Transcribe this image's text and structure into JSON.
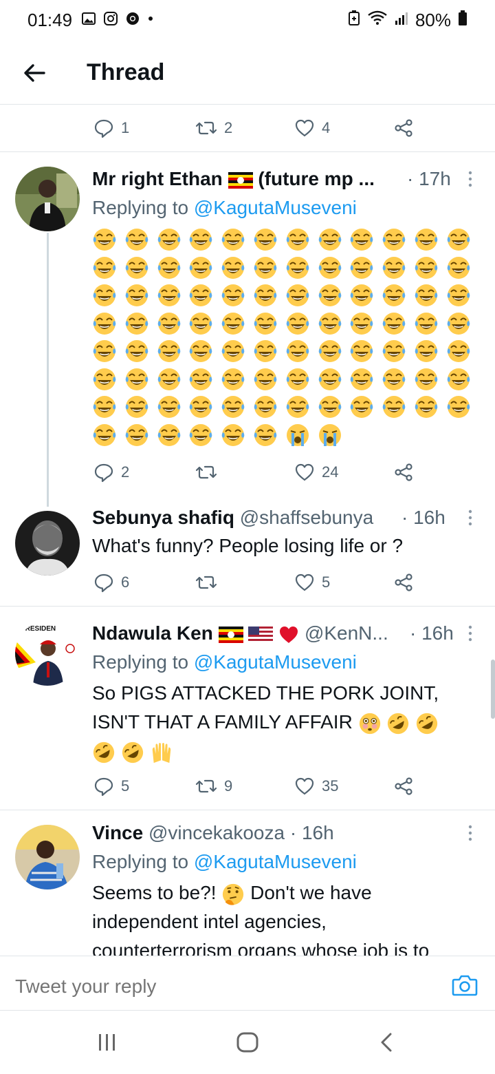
{
  "status_bar": {
    "time": "01:49",
    "battery": "80%"
  },
  "header": {
    "title": "Thread"
  },
  "top_actions": {
    "replies": "1",
    "retweets": "2",
    "likes": "4"
  },
  "tweets": [
    {
      "name": "Mr right Ethan",
      "name_suffix": "(future mp ...",
      "handle": "",
      "time": "· 17h",
      "replying_prefix": "Replying to ",
      "replying_to": "@KagutaMuseveni",
      "text_lines": [],
      "emoji_laughing_count": 90,
      "emoji_crying_count": 2,
      "actions": {
        "replies": "2",
        "retweets": "",
        "likes": "24"
      }
    },
    {
      "name": "Sebunya shafiq",
      "handle": "@shaffsebunya",
      "time": "· 16h",
      "text_lines": [
        "What's funny? People losing life or ?"
      ],
      "actions": {
        "replies": "6",
        "retweets": "",
        "likes": "5"
      }
    },
    {
      "name": "Ndawula Ken",
      "handle": "@KenN...",
      "time": "· 16h",
      "replying_prefix": "Replying to ",
      "replying_to": "@KagutaMuseveni",
      "text_lines": [
        "So PIGS ATTACKED THE PORK JOINT,",
        "ISN'T THAT A FAMILY AFFAIR"
      ],
      "avatar_caption": "PRESIDEN",
      "actions": {
        "replies": "5",
        "retweets": "9",
        "likes": "35"
      }
    },
    {
      "name": "Vince",
      "handle": "@vincekakooza",
      "time": "· 16h",
      "replying_prefix": "Replying to ",
      "replying_to": "@KagutaMuseveni",
      "text_lines": [
        "Seems to be?!",
        "Don't we have",
        "independent intel agencies,",
        "counterterrorism organs whose job is to"
      ]
    }
  ],
  "reply_bar": {
    "placeholder": "Tweet your reply"
  },
  "colors": {
    "accent": "#1d9bf0",
    "secondary_text": "#536471",
    "divider": "#e1e5e8",
    "like_red": "#e0245e"
  }
}
